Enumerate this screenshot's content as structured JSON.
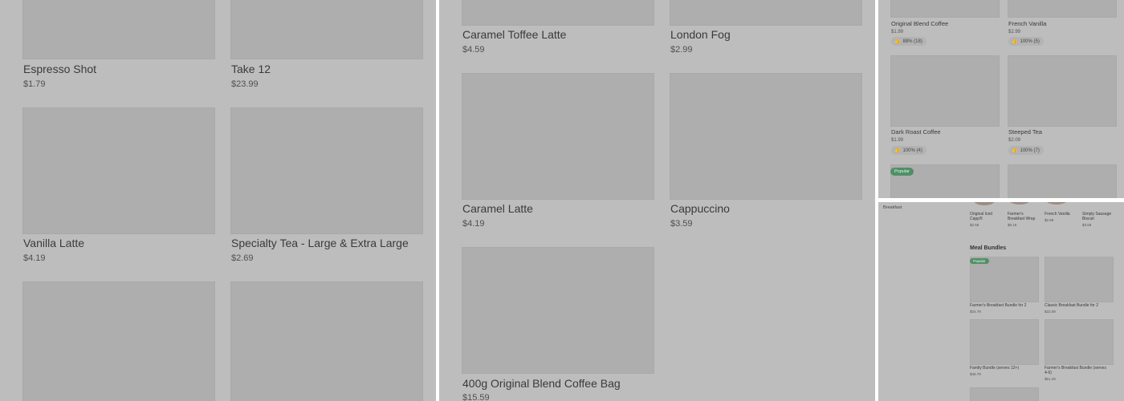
{
  "panel1": {
    "items": [
      {
        "name": "Espresso Shot",
        "price": "$1.79"
      },
      {
        "name": "Take 12",
        "price": "$23.99"
      },
      {
        "name": "Vanilla Latte",
        "price": "$4.19"
      },
      {
        "name": "Specialty Tea - Large & Extra Large",
        "price": "$2.69"
      }
    ]
  },
  "panel2": {
    "items": [
      {
        "name": "Caramel Toffee Latte",
        "price": "$4.59"
      },
      {
        "name": "London Fog",
        "price": "$2.99"
      },
      {
        "name": "Caramel Latte",
        "price": "$4.19"
      },
      {
        "name": "Cappuccino",
        "price": "$3.59"
      },
      {
        "name": "400g Original Blend Coffee Bag",
        "price": "$15.59"
      }
    ]
  },
  "panel3": {
    "items": [
      {
        "name": "Original Blend Coffee",
        "price": "$1.99",
        "rating": "88% (18)"
      },
      {
        "name": "French Vanilla",
        "price": "$2.99",
        "rating": "100% (5)"
      },
      {
        "name": "Dark Roast Coffee",
        "price": "$1.99",
        "rating": "100% (4)"
      },
      {
        "name": "Steeped Tea",
        "price": "$2.09",
        "rating": "100% (7)"
      }
    ],
    "badge": "Popular",
    "thumb_icon": "thumbs-up-icon"
  },
  "panel4": {
    "sidebar_label": "Breakfast",
    "top_items": [
      {
        "name": "Original Iced Capp®",
        "price": "$2.59"
      },
      {
        "name": "Farmer's Breakfast Wrap",
        "price": "$5.19"
      },
      {
        "name": "French Vanilla",
        "price": "$2.99"
      },
      {
        "name": "Simply Sausage Biscuit",
        "price": "$3.59"
      }
    ],
    "section_title": "Meal Bundles",
    "badge": "Popular",
    "bundles": [
      {
        "name": "Farmer's Breakfast Bundle for 2",
        "price": "$24.79"
      },
      {
        "name": "Classic Breakfast Bundle for 2",
        "price": "$22.09"
      },
      {
        "name": "Family Bundle (serves 12+)",
        "price": "$46.79"
      },
      {
        "name": "Farmer's Breakfast Bundle (serves 4-6)",
        "price": "$51.29"
      }
    ]
  }
}
